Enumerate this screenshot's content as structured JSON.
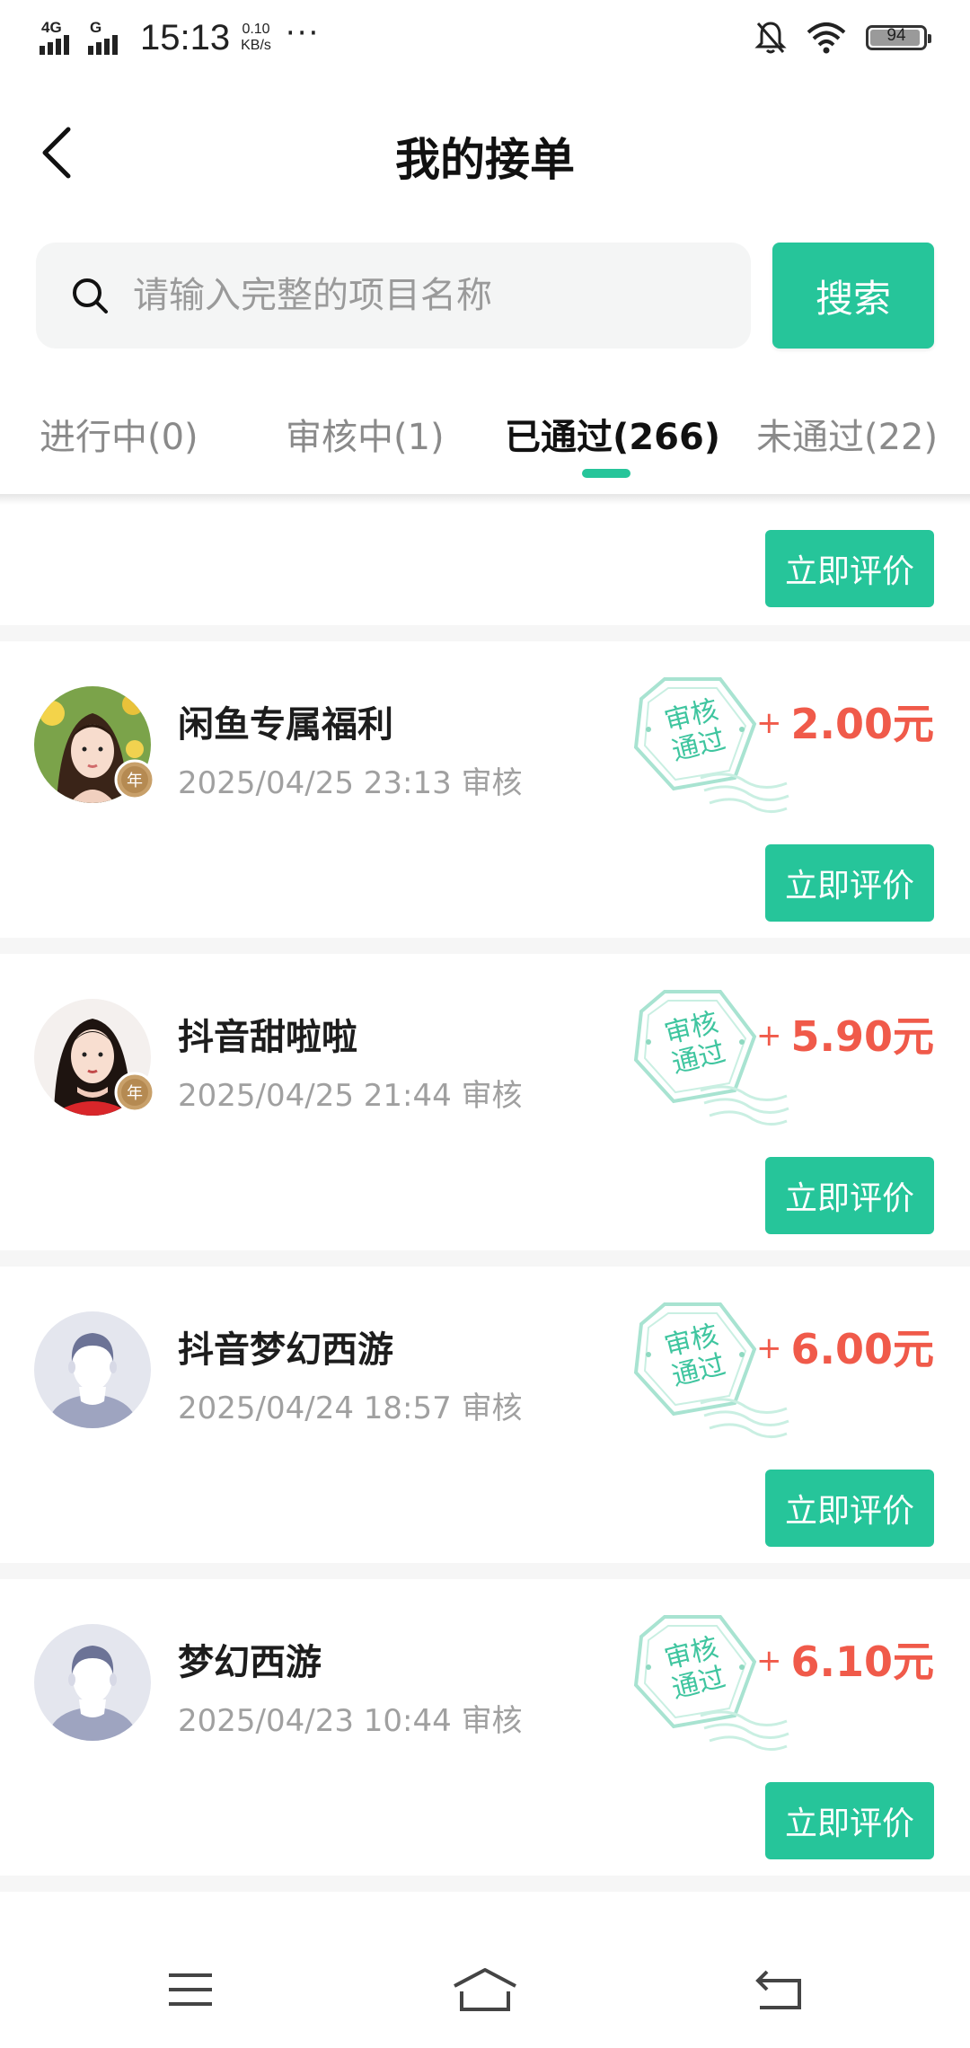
{
  "status_bar": {
    "network": "4G",
    "network2": "G",
    "time": "15:13",
    "speed_value": "0.10",
    "speed_unit": "KB/s",
    "more": "···",
    "battery": "94",
    "battery_level": 0.94
  },
  "nav": {
    "title": "我的接单"
  },
  "search": {
    "placeholder": "请输入完整的项目名称",
    "value": "",
    "button_label": "搜索"
  },
  "tabs": [
    {
      "label": "进行中(0)"
    },
    {
      "label": "审核中(1)"
    },
    {
      "label": "已通过(266)",
      "active": true
    },
    {
      "label": "未通过(22)"
    }
  ],
  "stamp": {
    "line1": "审核",
    "line2": "通过"
  },
  "badge_text": "年",
  "items": [
    {
      "title": "闲鱼专属福利",
      "time": "2025/04/25 23:13 审核",
      "amount": "2.00元",
      "plus": "+",
      "action": "立即评价",
      "avatar": "photo-woman-yellow"
    },
    {
      "title": "抖音甜啦啦",
      "time": "2025/04/25 21:44 审核",
      "amount": "5.90元",
      "plus": "+",
      "action": "立即评价",
      "avatar": "photo-woman-red"
    },
    {
      "title": "抖音梦幻西游",
      "time": "2025/04/24 18:57 审核",
      "amount": "6.00元",
      "plus": "+",
      "action": "立即评价",
      "avatar": "default-user-icon"
    },
    {
      "title": "梦幻西游",
      "time": "2025/04/23 10:44 审核",
      "amount": "6.10元",
      "plus": "+",
      "action": "立即评价",
      "avatar": "default-user-icon"
    }
  ],
  "partial_item": {
    "action": "立即评价"
  },
  "colors": {
    "accent": "#26c59a",
    "amount": "#f05a4a",
    "muted": "#a0a0a0"
  }
}
